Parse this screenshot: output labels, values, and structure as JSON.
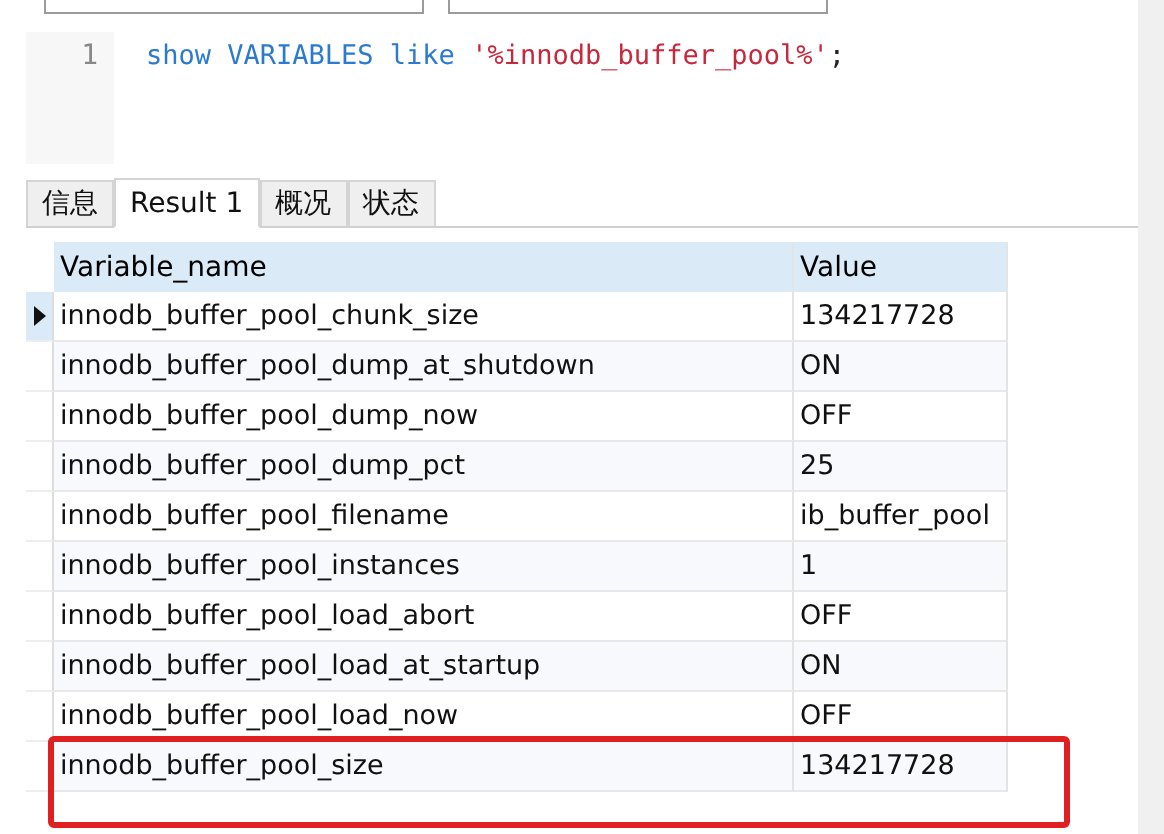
{
  "editor": {
    "line_number": "1",
    "query": [
      {
        "kind": "keyword",
        "text": "show VARIABLES like"
      },
      {
        "kind": "string",
        "text": "'%innodb_buffer_pool%'"
      },
      {
        "kind": "plain",
        "text": ";"
      }
    ]
  },
  "tabs": [
    {
      "label": "信息",
      "selected": false
    },
    {
      "label": "Result 1",
      "selected": true
    },
    {
      "label": "概况",
      "selected": false
    },
    {
      "label": "状态",
      "selected": false
    }
  ],
  "table": {
    "columns": [
      "Variable_name",
      "Value"
    ],
    "rows": [
      {
        "cells": [
          "innodb_buffer_pool_chunk_size",
          "134217728"
        ],
        "selected": true,
        "highlighted": false
      },
      {
        "cells": [
          "innodb_buffer_pool_dump_at_shutdown",
          "ON"
        ],
        "selected": false,
        "highlighted": false
      },
      {
        "cells": [
          "innodb_buffer_pool_dump_now",
          "OFF"
        ],
        "selected": false,
        "highlighted": false
      },
      {
        "cells": [
          "innodb_buffer_pool_dump_pct",
          "25"
        ],
        "selected": false,
        "highlighted": false
      },
      {
        "cells": [
          "innodb_buffer_pool_filename",
          "ib_buffer_pool"
        ],
        "selected": false,
        "highlighted": false
      },
      {
        "cells": [
          "innodb_buffer_pool_instances",
          "1"
        ],
        "selected": false,
        "highlighted": false
      },
      {
        "cells": [
          "innodb_buffer_pool_load_abort",
          "OFF"
        ],
        "selected": false,
        "highlighted": false
      },
      {
        "cells": [
          "innodb_buffer_pool_load_at_startup",
          "ON"
        ],
        "selected": false,
        "highlighted": false
      },
      {
        "cells": [
          "innodb_buffer_pool_load_now",
          "OFF"
        ],
        "selected": false,
        "highlighted": false
      },
      {
        "cells": [
          "innodb_buffer_pool_size",
          "134217728"
        ],
        "selected": false,
        "highlighted": true
      }
    ]
  }
}
